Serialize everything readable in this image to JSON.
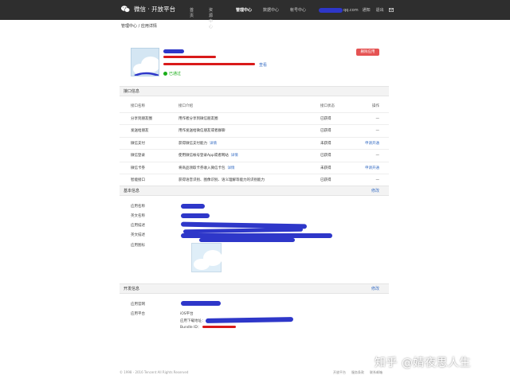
{
  "topbar": {
    "brand": "微信 · 开放平台",
    "nav": [
      "首页",
      "资源中心",
      "管理中心",
      "数据中心",
      "帐号中心"
    ],
    "active_nav": "管理中心",
    "email_suffix": "qq.com",
    "notice": "通知",
    "logout": "退出"
  },
  "breadcrumb": "管理中心 / 应用详情",
  "app_header": {
    "status": "已通过",
    "edit": "查看",
    "delete": "删除应用"
  },
  "interfaces": {
    "section_title": "接口信息",
    "columns": [
      "接口名称",
      "接口介绍",
      "接口状态",
      "操作"
    ],
    "rows": [
      {
        "name": "分享到朋友圈",
        "desc": "用作者分享到微信朋友圈",
        "link": "",
        "status": "已获得",
        "op": "—"
      },
      {
        "name": "发送给朋友",
        "desc": "用作发送给微信朋友或者群聊",
        "link": "",
        "status": "已获得",
        "op": "—"
      },
      {
        "name": "微信支付",
        "desc": "获得微信支付能力",
        "link": "详情",
        "status": "未获得",
        "op": "申请开通"
      },
      {
        "name": "微信登录",
        "desc": "使用微信帐号登录App或者网站",
        "link": "详情",
        "status": "已获得",
        "op": "—"
      },
      {
        "name": "微信卡券",
        "desc": "将商品领取卡券收入微信卡包",
        "link": "详情",
        "status": "未获得",
        "op": "申请开通"
      },
      {
        "name": "智能接口",
        "desc": "获得语音识别、图像识别、语义理解等能力的识别能力",
        "link": "",
        "status": "已获得",
        "op": "—"
      }
    ]
  },
  "basic": {
    "section_title": "基本信息",
    "action": "修改",
    "labels": [
      "应用名称",
      "英文名称",
      "应用描述",
      "英文描述",
      "应用图标"
    ]
  },
  "dev": {
    "section_title": "开发信息",
    "action": "修改",
    "labels": [
      "应用官网",
      "应用平台"
    ],
    "platform": "iOS平台",
    "download_label": "应用下载地址：",
    "bundle_label": "Bundle ID："
  },
  "footer": {
    "copyright": "© 1998 - 2016 Tencent All Rights Reserved",
    "links": [
      "开放平台",
      "服务条款",
      "联系邮箱"
    ]
  },
  "watermark": "知乎 @婧夜思人生",
  "colors": {
    "topbar": "#2e2e2e",
    "link": "#3a6fc4",
    "danger": "#e55353",
    "success": "#1aad19",
    "redaction_blue": "#2e37c9",
    "redaction_red": "#d91a1a"
  }
}
